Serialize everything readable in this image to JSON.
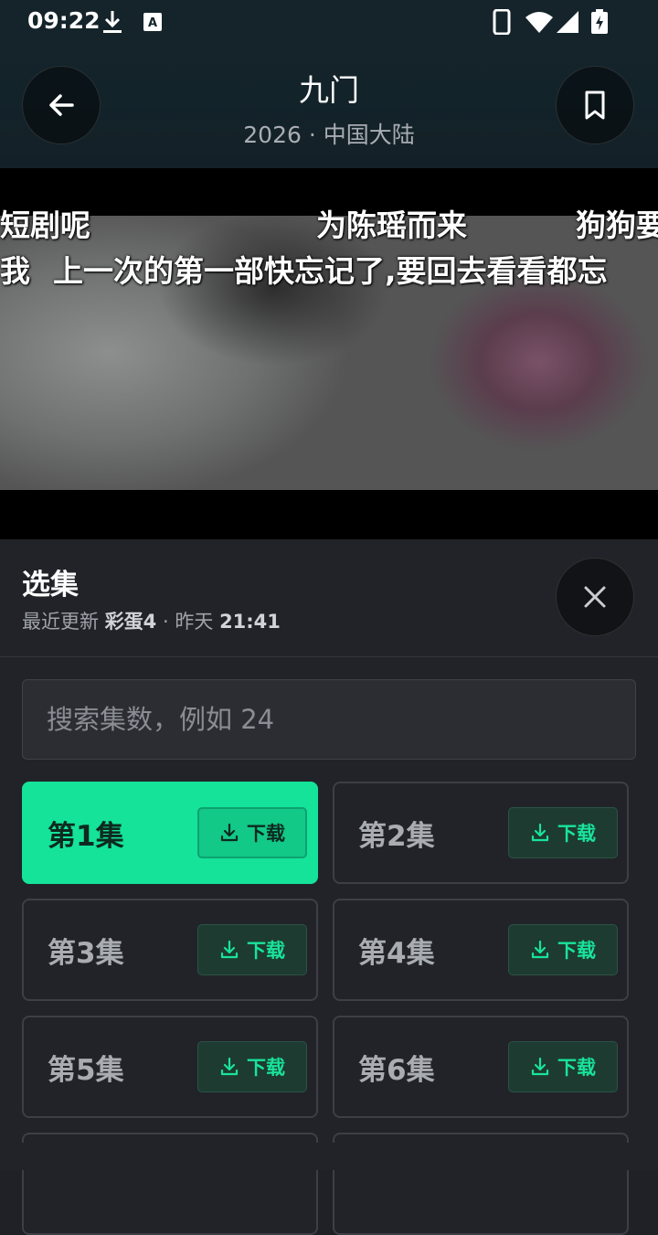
{
  "status": {
    "time": "09:22"
  },
  "header": {
    "title": "九门",
    "subtitle": "2026 · 中国大陆"
  },
  "danmaku": [
    "短剧呢",
    "为陈瑶而来",
    "狗狗要",
    "我",
    "上一次的第一部快忘记了,要回去看看都忘"
  ],
  "panel": {
    "title": "选集",
    "sub_prefix": "最近更新",
    "sub_latest": "彩蛋4",
    "sub_sep": "·",
    "sub_day": "昨天",
    "sub_time": "21:41",
    "search_placeholder": "搜索集数，例如 24",
    "download_label": "下载",
    "episodes": [
      "第1集",
      "第2集",
      "第3集",
      "第4集",
      "第5集",
      "第6集"
    ],
    "selected_episode": "第1集"
  },
  "colors": {
    "accent": "#15e39a",
    "panel_bg": "#212328"
  },
  "icons": [
    "back-arrow-icon",
    "bookmark-icon",
    "close-icon",
    "download-icon",
    "wifi-icon",
    "signal-icon",
    "battery-icon"
  ]
}
